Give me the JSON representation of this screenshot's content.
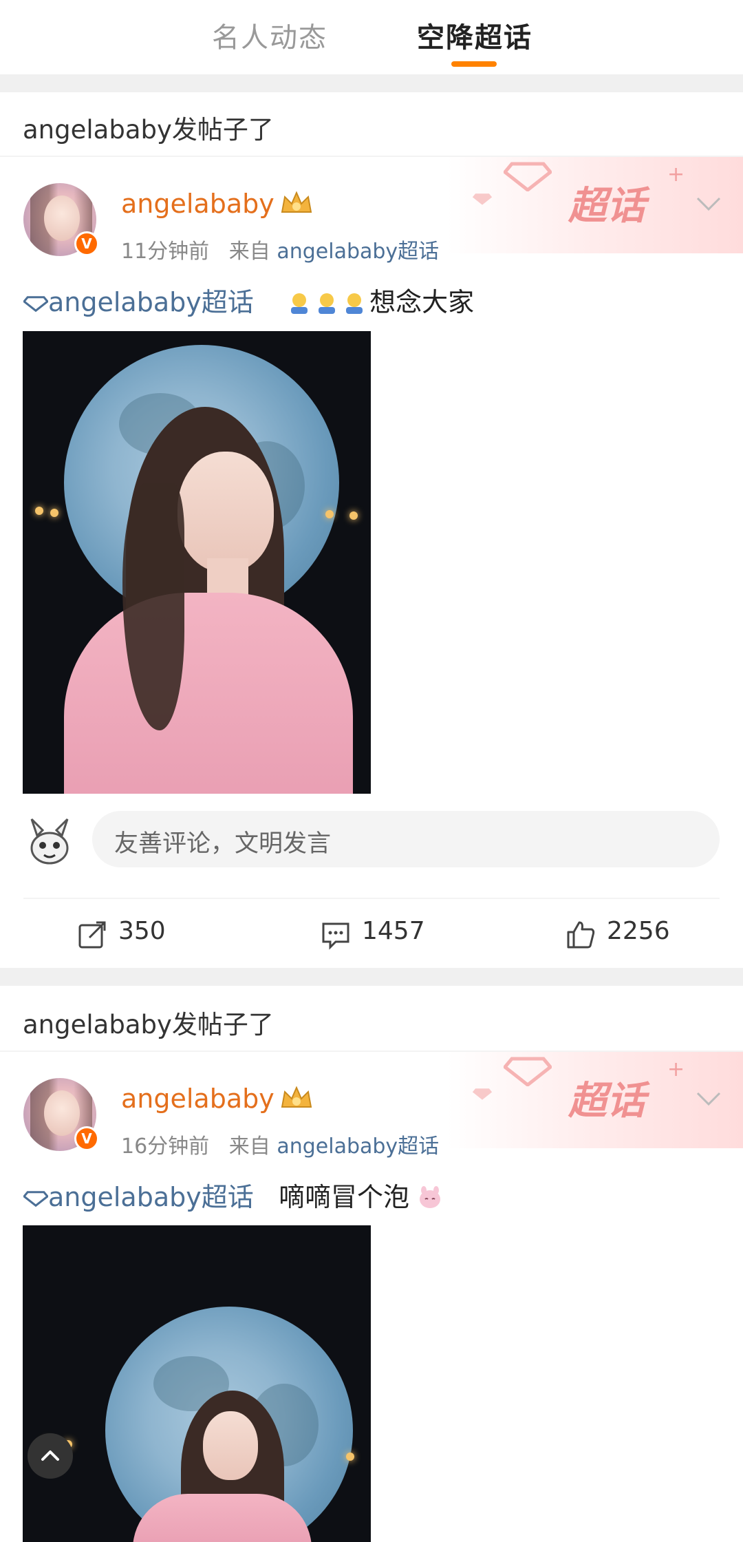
{
  "tabs": [
    "名人动态",
    "空降超话"
  ],
  "active_tab": 1,
  "posts": [
    {
      "header": "angelababy发帖子了",
      "banner_text": "超话",
      "username": "angelababy",
      "time": "11分钟前",
      "from_label": "来自",
      "source": "angelababy超话",
      "topic": "angelababy超话",
      "text": "想念大家",
      "comment_placeholder": "友善评论，文明发言",
      "reposts": "350",
      "comments": "1457",
      "likes": "2256"
    },
    {
      "header": "angelababy发帖子了",
      "banner_text": "超话",
      "username": "angelababy",
      "time": "16分钟前",
      "from_label": "来自",
      "source": "angelababy超话",
      "topic": "angelababy超话",
      "text": "嘀嘀冒个泡"
    }
  ],
  "colors": {
    "accent": "#ff8200",
    "username": "#e46f1c",
    "link": "#4b6f96"
  },
  "icons": [
    "crown-icon",
    "verified-icon",
    "diamond-icon",
    "chevron-down-icon",
    "repost-icon",
    "comment-icon",
    "like-icon",
    "scroll-top-icon"
  ]
}
